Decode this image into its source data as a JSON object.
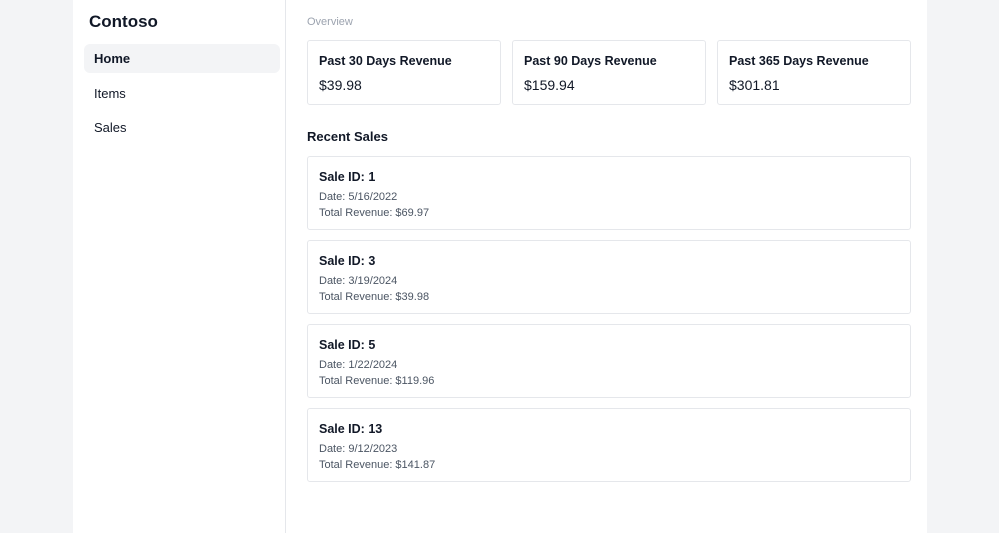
{
  "brand": {
    "name": "Contoso"
  },
  "sidebar": {
    "items": [
      {
        "label": "Home",
        "active": true
      },
      {
        "label": "Items",
        "active": false
      },
      {
        "label": "Sales",
        "active": false
      }
    ]
  },
  "main": {
    "overview_label": "Overview",
    "stats": [
      {
        "title": "Past 30 Days Revenue",
        "value": "$39.98"
      },
      {
        "title": "Past 90 Days Revenue",
        "value": "$159.94"
      },
      {
        "title": "Past 365 Days Revenue",
        "value": "$301.81"
      }
    ],
    "recent_sales_heading": "Recent Sales",
    "sales": [
      {
        "title": "Sale ID: 1",
        "date": "Date: 5/16/2022",
        "revenue": "Total Revenue: $69.97"
      },
      {
        "title": "Sale ID: 3",
        "date": "Date: 3/19/2024",
        "revenue": "Total Revenue: $39.98"
      },
      {
        "title": "Sale ID: 5",
        "date": "Date: 1/22/2024",
        "revenue": "Total Revenue: $119.96"
      },
      {
        "title": "Sale ID: 13",
        "date": "Date: 9/12/2023",
        "revenue": "Total Revenue: $141.87"
      }
    ]
  }
}
